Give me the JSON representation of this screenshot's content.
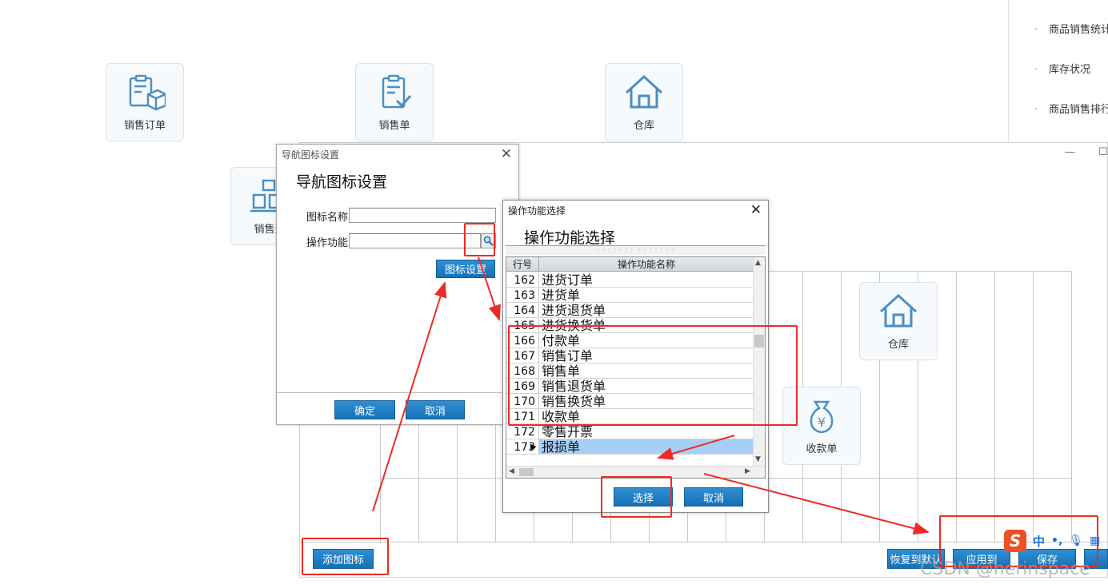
{
  "tiles_top": [
    {
      "label": "销售订单",
      "icon": "order-box-icon"
    },
    {
      "label": "销售单",
      "icon": "clipboard-check-icon"
    },
    {
      "label": "仓库",
      "icon": "warehouse-house-icon"
    }
  ],
  "tile_partial": {
    "label": "销售退",
    "icon": "return-boxes-icon"
  },
  "right_list": [
    "商品销售统计",
    "库存状况",
    "商品销售排行"
  ],
  "big_window": {
    "tiles": [
      {
        "label": "仓库",
        "icon": "warehouse-house-icon"
      },
      {
        "label": "收款单",
        "icon": "money-bag-icon"
      }
    ],
    "buttons": {
      "add_icon": "添加图标",
      "restore_default": "恢复到默认",
      "apply_to": "应用到",
      "save": "保存"
    }
  },
  "nav_dialog": {
    "title_bar": "导航图标设置",
    "heading": "导航图标设置",
    "icon_name_label": "图标名称",
    "icon_name_value": "",
    "function_label": "操作功能",
    "function_value": "",
    "icon_setting_button": "图标设置",
    "ok_button": "确定",
    "cancel_button": "取消"
  },
  "func_dialog": {
    "title_bar": "操作功能选择",
    "heading": "操作功能选择",
    "columns": [
      "行号",
      "操作功能名称"
    ],
    "rows": [
      {
        "no": "162",
        "name": "进货订单"
      },
      {
        "no": "163",
        "name": "进货单"
      },
      {
        "no": "164",
        "name": "进货退货单"
      },
      {
        "no": "165",
        "name": "进货换货单"
      },
      {
        "no": "166",
        "name": "付款单"
      },
      {
        "no": "167",
        "name": "销售订单"
      },
      {
        "no": "168",
        "name": "销售单"
      },
      {
        "no": "169",
        "name": "销售退货单"
      },
      {
        "no": "170",
        "name": "销售换货单"
      },
      {
        "no": "171",
        "name": "收款单"
      },
      {
        "no": "172",
        "name": "零售开票"
      },
      {
        "no": "173",
        "name": "报损单"
      }
    ],
    "selected_row": 11,
    "select_button": "选择",
    "cancel_button": "取消"
  },
  "ime": {
    "mode": "中"
  },
  "watermark": "CSDN @herinspace",
  "colors": {
    "annotation_red": "#ee2a24",
    "button_blue": "#1e7fc6",
    "selection": "#a6cff5"
  }
}
